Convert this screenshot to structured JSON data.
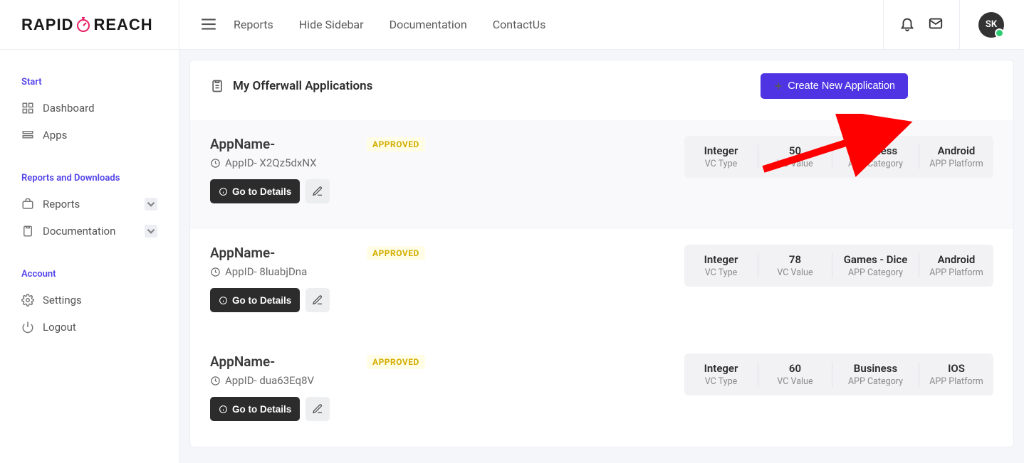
{
  "brand": {
    "left": "RAPID",
    "right": "REACH"
  },
  "topnav": {
    "reports": "Reports",
    "hide_sidebar": "Hide Sidebar",
    "documentation": "Documentation",
    "contact": "ContactUs"
  },
  "avatar_initials": "SK",
  "sidebar": {
    "start_label": "Start",
    "dashboard": "Dashboard",
    "apps": "Apps",
    "reports_downloads_label": "Reports and Downloads",
    "reports": "Reports",
    "documentation": "Documentation",
    "account_label": "Account",
    "settings": "Settings",
    "logout": "Logout"
  },
  "panel": {
    "title": "My Offerwall Applications",
    "create_button": "Create New Application",
    "stat_labels": {
      "vc_type": "VC Type",
      "vc_value": "VC Value",
      "app_category": "APP Category",
      "app_platform": "APP Platform"
    },
    "go_to_details": "Go to Details",
    "apps": [
      {
        "name": "AppName-",
        "status": "APPROVED",
        "appid_prefix": "AppID-",
        "appid": "X2Qz5dxNX",
        "vc_type": "Integer",
        "vc_value": "50",
        "category": "Business",
        "platform": "Android"
      },
      {
        "name": "AppName-",
        "status": "APPROVED",
        "appid_prefix": "AppID-",
        "appid": "8luabjDna",
        "vc_type": "Integer",
        "vc_value": "78",
        "category": "Games - Dice",
        "platform": "Android"
      },
      {
        "name": "AppName-",
        "status": "APPROVED",
        "appid_prefix": "AppID-",
        "appid": "dua63Eq8V",
        "vc_type": "Integer",
        "vc_value": "60",
        "category": "Business",
        "platform": "IOS"
      }
    ]
  }
}
